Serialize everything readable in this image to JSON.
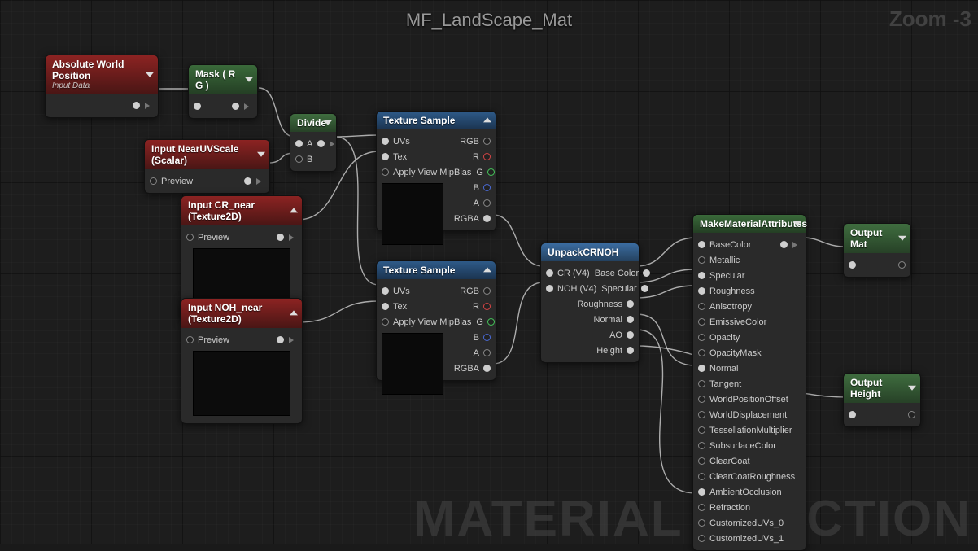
{
  "canvas": {
    "title": "MF_LandScape_Mat",
    "zoom_label": "Zoom -3",
    "footer_watermark": "MATERIAL FUNCTION"
  },
  "nodes": {
    "awp": {
      "title": "Absolute World Position",
      "subtitle": "Input Data"
    },
    "mask": {
      "title": "Mask ( R G )"
    },
    "divide": {
      "title": "Divide",
      "in_a": "A",
      "in_b": "B"
    },
    "near_uv": {
      "title": "Input NearUVScale (Scalar)",
      "preview": "Preview"
    },
    "cr_near": {
      "title": "Input CR_near (Texture2D)",
      "preview": "Preview"
    },
    "noh_near": {
      "title": "Input NOH_near (Texture2D)",
      "preview": "Preview"
    },
    "tex1": {
      "title": "Texture Sample",
      "uvs": "UVs",
      "tex": "Tex",
      "mip": "Apply View MipBias",
      "rgb": "RGB",
      "r": "R",
      "g": "G",
      "b": "B",
      "a": "A",
      "rgba": "RGBA"
    },
    "tex2": {
      "title": "Texture Sample",
      "uvs": "UVs",
      "tex": "Tex",
      "mip": "Apply View MipBias",
      "rgb": "RGB",
      "r": "R",
      "g": "G",
      "b": "B",
      "a": "A",
      "rgba": "RGBA"
    },
    "unpack": {
      "title": "UnpackCRNOH",
      "cr": "CR (V4)",
      "noh": "NOH (V4)",
      "basecolor": "Base Color",
      "specular": "Specular",
      "roughness": "Roughness",
      "normal": "Normal",
      "ao": "AO",
      "height": "Height"
    },
    "mma": {
      "title": "MakeMaterialAttributes",
      "pins": [
        "BaseColor",
        "Metallic",
        "Specular",
        "Roughness",
        "Anisotropy",
        "EmissiveColor",
        "Opacity",
        "OpacityMask",
        "Normal",
        "Tangent",
        "WorldPositionOffset",
        "WorldDisplacement",
        "TessellationMultiplier",
        "SubsurfaceColor",
        "ClearCoat",
        "ClearCoatRoughness",
        "AmbientOcclusion",
        "Refraction",
        "CustomizedUVs_0",
        "CustomizedUVs_1"
      ]
    },
    "out_mat": {
      "title": "Output Mat"
    },
    "out_height": {
      "title": "Output Height"
    }
  }
}
